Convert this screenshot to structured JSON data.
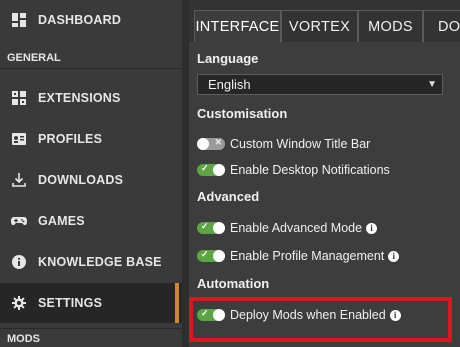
{
  "sidebar": {
    "top_item": {
      "label": "DASHBOARD",
      "icon": "dashboard-icon"
    },
    "section_general": "GENERAL",
    "items": [
      {
        "label": "EXTENSIONS",
        "icon": "extensions-icon"
      },
      {
        "label": "PROFILES",
        "icon": "profiles-icon"
      },
      {
        "label": "DOWNLOADS",
        "icon": "downloads-icon"
      },
      {
        "label": "GAMES",
        "icon": "gamepad-icon"
      },
      {
        "label": "KNOWLEDGE BASE",
        "icon": "info-icon"
      },
      {
        "label": "SETTINGS",
        "icon": "gear-icon",
        "active": true
      }
    ],
    "section_mods": "MODS",
    "accent_color": "#d0872a"
  },
  "tabs": [
    {
      "label": "INTERFACE",
      "active": true
    },
    {
      "label": "VORTEX"
    },
    {
      "label": "MODS"
    },
    {
      "label": "DOW"
    }
  ],
  "language": {
    "heading": "Language",
    "selected": "English"
  },
  "customisation": {
    "heading": "Customisation",
    "custom_title_bar": {
      "label": "Custom Window Title Bar",
      "enabled": false
    },
    "desktop_notifications": {
      "label": "Enable Desktop Notifications",
      "enabled": true
    }
  },
  "advanced": {
    "heading": "Advanced",
    "advanced_mode": {
      "label": "Enable Advanced Mode",
      "enabled": true
    },
    "profile_management": {
      "label": "Enable Profile Management",
      "enabled": true
    }
  },
  "automation": {
    "heading": "Automation",
    "deploy_mods": {
      "label": "Deploy Mods when Enabled",
      "enabled": true
    }
  },
  "colors": {
    "toggle_on": "#5ba545",
    "highlight_box": "#e0141e"
  }
}
